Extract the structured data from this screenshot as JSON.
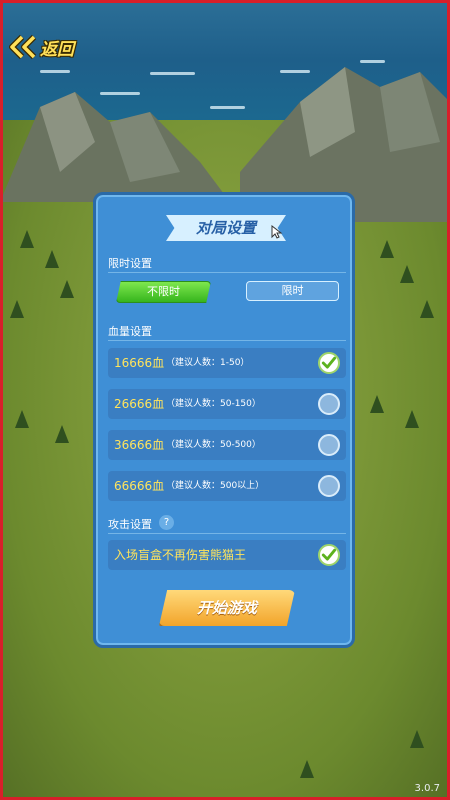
{
  "nav": {
    "back_label": "返回"
  },
  "version": "3.0.7",
  "panel": {
    "title": "对局设置",
    "time_section": {
      "label": "限时设置",
      "unlimited_label": "不限时",
      "limited_label": "限时",
      "selected": "unlimited"
    },
    "hp_section": {
      "label": "血量设置",
      "options": [
        {
          "amount": "16666血",
          "hint": "（建议人数：1-50）",
          "checked": true
        },
        {
          "amount": "26666血",
          "hint": "（建议人数：50-150）",
          "checked": false
        },
        {
          "amount": "36666血",
          "hint": "（建议人数：50-500）",
          "checked": false
        },
        {
          "amount": "66666血",
          "hint": "（建议人数：500以上）",
          "checked": false
        }
      ]
    },
    "attack_section": {
      "label": "攻击设置",
      "help": "?",
      "toggle_label": "入场盲盒不再伤害熊猫王",
      "toggle_checked": true
    },
    "start_label": "开始游戏"
  },
  "colors": {
    "panel": "#3f8fd6",
    "accent_yellow": "#ffe45c",
    "green_button": "#36b51d",
    "start_button": "#f2a42a",
    "frame": "#d81f2a"
  }
}
